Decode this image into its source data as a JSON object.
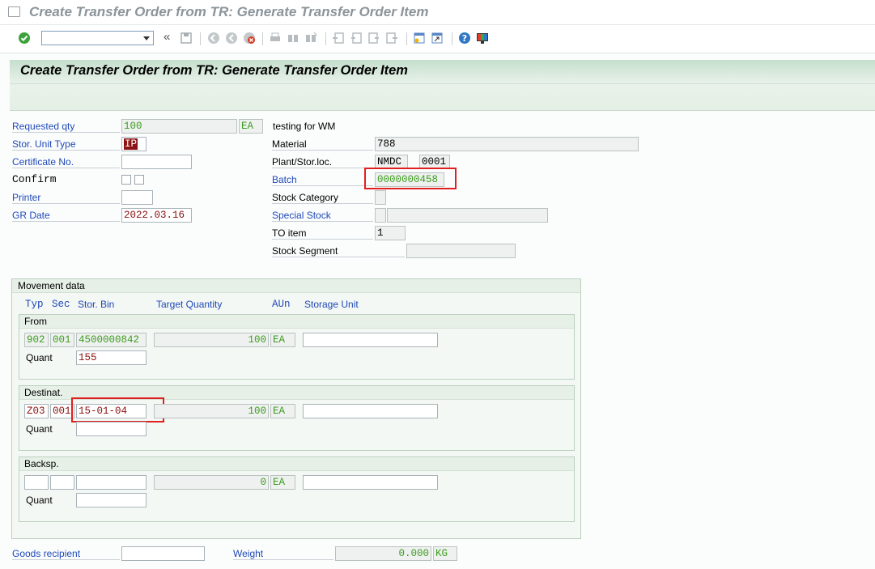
{
  "window": {
    "title": "Create Transfer Order from TR: Generate Transfer Order Item"
  },
  "toolbar": {
    "command_value": ""
  },
  "screen": {
    "title": "Create Transfer Order from TR: Generate Transfer Order Item"
  },
  "left_fields": {
    "requested_qty": {
      "label": "Requested qty",
      "value": "100",
      "unit": "EA"
    },
    "stor_unit_type": {
      "label": "Stor. Unit Type",
      "value": "IP"
    },
    "certificate_no": {
      "label": "Certificate No.",
      "value": ""
    },
    "confirm": {
      "label": "Confirm"
    },
    "printer": {
      "label": "Printer",
      "value": ""
    },
    "gr_date": {
      "label": "GR Date",
      "value": "2022.03.16"
    }
  },
  "right_fields": {
    "description": "testing for WM",
    "material": {
      "label": "Material",
      "value": "788"
    },
    "plant_sloc": {
      "label": "Plant/Stor.loc.",
      "plant": "NMDC",
      "sloc": "0001"
    },
    "batch": {
      "label": "Batch",
      "value": "0000000458"
    },
    "stock_category": {
      "label": "Stock Category",
      "value": ""
    },
    "special_stock": {
      "label": "Special Stock",
      "value": "",
      "value2": ""
    },
    "to_item": {
      "label": "TO item",
      "value": "1"
    },
    "stock_segment": {
      "label": "Stock Segment",
      "value": ""
    }
  },
  "movement": {
    "title": "Movement data",
    "columns": {
      "typ": "Typ",
      "sec": "Sec",
      "bin": "Stor. Bin",
      "target_qty": "Target Quantity",
      "aun": "AUn",
      "storage_unit": "Storage Unit"
    },
    "from": {
      "title": "From",
      "typ": "902",
      "sec": "001",
      "bin": "4500000842",
      "qty": "100",
      "aun": "EA",
      "storage_unit": "",
      "quant_label": "Quant",
      "quant": "155"
    },
    "dest": {
      "title": "Destinat.",
      "typ": "Z03",
      "sec": "001",
      "bin": "15-01-04",
      "qty": "100",
      "aun": "EA",
      "storage_unit": "",
      "quant_label": "Quant",
      "quant": ""
    },
    "backsp": {
      "title": "Backsp.",
      "typ": "",
      "sec": "",
      "bin": "",
      "qty": "0",
      "aun": "EA",
      "storage_unit": "",
      "quant_label": "Quant",
      "quant": ""
    }
  },
  "footer": {
    "goods_recipient": {
      "label": "Goods recipient",
      "value": ""
    },
    "weight": {
      "label": "Weight",
      "value": "0.000",
      "unit": "KG"
    }
  },
  "icons": [
    "enter-icon",
    "back-icon",
    "save-icon",
    "exit-icon",
    "cancel-icon",
    "print-icon",
    "find-icon",
    "find-next-icon",
    "first-page-icon",
    "prev-page-icon",
    "next-page-icon",
    "last-page-icon",
    "new-session-icon",
    "shortcut-icon",
    "help-icon",
    "customize-icon"
  ],
  "colors": {
    "header_green": "#c6dfcc",
    "label_blue": "#1f48b8",
    "value_green": "#3d9c1e",
    "highlight_red": "#e0201e"
  }
}
